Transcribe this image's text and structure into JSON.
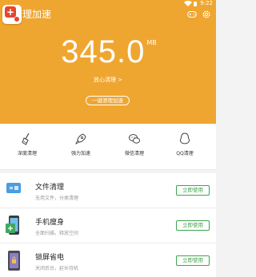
{
  "status_bar": {
    "time": "9:22"
  },
  "header": {
    "title": "理加速"
  },
  "hero": {
    "value": "345.0",
    "unit": "MB",
    "link": "放心清理 >",
    "button": "一键清理加速"
  },
  "tools": [
    {
      "label": "深度清理",
      "icon": "broom-icon"
    },
    {
      "label": "强力加速",
      "icon": "rocket-icon"
    },
    {
      "label": "微信清理",
      "icon": "wechat-icon"
    },
    {
      "label": "QQ清理",
      "icon": "qq-icon"
    }
  ],
  "list": [
    {
      "title": "文件清理",
      "desc": "无用文件，分类清理",
      "button": "立即使用",
      "icon": "files-icon"
    },
    {
      "title": "手机瘦身",
      "desc": "全面扫描，释放空间",
      "button": "立即使用",
      "icon": "phone-slim-icon"
    },
    {
      "title": "锁屏省电",
      "desc": "关闭后台，延长待机",
      "button": "立即使用",
      "icon": "lock-battery-icon"
    }
  ],
  "colors": {
    "brand": "#efa630",
    "accent_green": "#3fa34d",
    "logo_red": "#e4462f"
  }
}
